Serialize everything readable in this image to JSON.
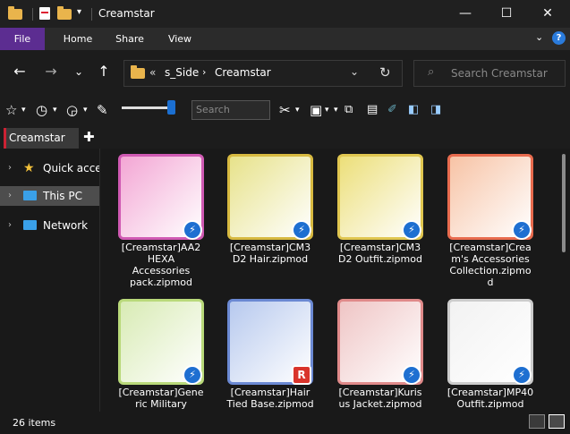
{
  "window": {
    "title": "Creamstar",
    "controls": [
      "minimize",
      "maximize",
      "close"
    ]
  },
  "ribbon": {
    "tabs": [
      "File",
      "Home",
      "Share",
      "View"
    ],
    "help": "?"
  },
  "nav": {
    "breadcrumb": [
      "«",
      "s_Side",
      "Creamstar"
    ],
    "search_placeholder": "Search Creamstar"
  },
  "toolbar": {
    "search_placeholder": "Search",
    "zoom_level": 0.92
  },
  "tabs": [
    {
      "label": "Creamstar",
      "active": true
    }
  ],
  "sidebar": {
    "items": [
      {
        "label": "Quick access",
        "icon": "star-icon",
        "selected": false
      },
      {
        "label": "This PC",
        "icon": "monitor-icon",
        "selected": true
      },
      {
        "label": "Network",
        "icon": "network-icon",
        "selected": false
      }
    ]
  },
  "files": [
    {
      "name": "[Creamstar]AA2\nHEXA\nAccessories\npack.zipmod",
      "thumb_color": "#f3a6d4",
      "frame": "#d05ab3",
      "badge": "blue"
    },
    {
      "name": "[Creamstar]CM3\nD2 Hair.zipmod",
      "thumb_color": "#e7e28a",
      "frame": "#d7b940",
      "badge": "blue"
    },
    {
      "name": "[Creamstar]CM3\nD2 Outfit.zipmod",
      "thumb_color": "#ecdf79",
      "frame": "#e0c650",
      "badge": "blue"
    },
    {
      "name": "[Creamstar]Crea\nm's Accessories\nCollection.zipmo\nd",
      "thumb_color": "#f7c3a5",
      "frame": "#e86b4e",
      "badge": "blue"
    },
    {
      "name": "[Creamstar]Gene\nric Military",
      "thumb_color": "#d8ebb4",
      "frame": "#b9d97a",
      "badge": "blue"
    },
    {
      "name": "[Creamstar]Hair\nTied Base.zipmod",
      "thumb_color": "#b7c9ee",
      "frame": "#6b89d3",
      "badge": "red"
    },
    {
      "name": "[Creamstar]Kuris\nus Jacket.zipmod",
      "thumb_color": "#efc5c5",
      "frame": "#e08a8a",
      "badge": "blue"
    },
    {
      "name": "[Creamstar]MP40\nOutfit.zipmod",
      "thumb_color": "#f2f2f2",
      "frame": "#cccccc",
      "badge": "blue"
    }
  ],
  "status": {
    "item_count": "26 items"
  },
  "colors": {
    "accent": "#5c2d91",
    "background": "#191919",
    "badge_blue": "#1e6fd1"
  }
}
